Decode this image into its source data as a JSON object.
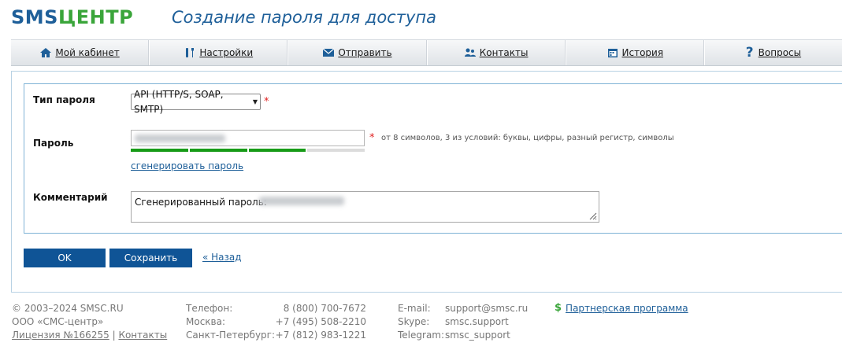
{
  "header": {
    "logo_part1": "SMS",
    "logo_part2": "ЦЕНТР",
    "title": "Создание пароля для доступа"
  },
  "nav": {
    "items": [
      {
        "label": "Мой кабинет",
        "icon": "home-icon"
      },
      {
        "label": "Настройки",
        "icon": "tools-icon"
      },
      {
        "label": "Отправить",
        "icon": "envelope-icon"
      },
      {
        "label": "Контакты",
        "icon": "contacts-icon"
      },
      {
        "label": "История",
        "icon": "calendar-icon"
      },
      {
        "label": "Вопросы",
        "icon": "question-icon"
      }
    ]
  },
  "form": {
    "type_label": "Тип пароля",
    "type_value": "API (HTTP/S, SOAP, SMTP)",
    "password_label": "Пароль",
    "password_hint": "от 8 символов, 3 из условий: буквы, цифры, разный регистр, символы",
    "strength_filled": 3,
    "strength_total": 4,
    "generate_link": "сгенерировать пароль",
    "comment_label": "Комментарий",
    "comment_value": "Сгенерированный пароль:",
    "required_mark": "*"
  },
  "actions": {
    "ok_label": "OK",
    "save_label": "Сохранить",
    "back_label": "« Назад"
  },
  "footer": {
    "copyright": "© 2003–2024 SMSC.RU",
    "company": "ООО «СМС-центр»",
    "license": "Лицензия №166255",
    "separator": "|",
    "contacts": "Контакты",
    "phones": [
      {
        "label": "Телефон:",
        "value": "8 (800) 700-7672"
      },
      {
        "label": "Москва:",
        "value": "+7 (495) 508-2210"
      },
      {
        "label": "Санкт-Петербург:",
        "value": "+7 (812) 983-1221"
      }
    ],
    "messengers": [
      {
        "label": "E-mail:",
        "value": "support@smsc.ru"
      },
      {
        "label": "Skype:",
        "value": "smsc.support"
      },
      {
        "label": "Telegram:",
        "value": "smsc_support"
      }
    ],
    "partner_label": "Партнерская программа"
  }
}
